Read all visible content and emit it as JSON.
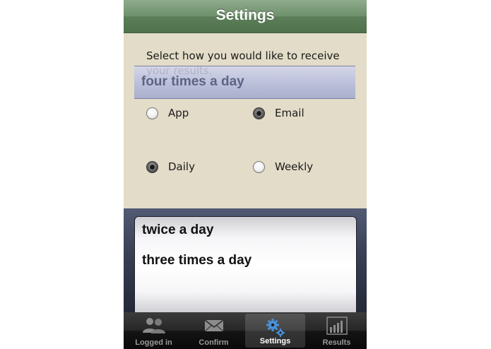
{
  "nav": {
    "title": "Settings"
  },
  "instructions": "Select how you would like to receive your results.",
  "options": {
    "app": {
      "label": "App",
      "checked": false
    },
    "email": {
      "label": "Email",
      "checked": true
    },
    "daily": {
      "label": "Daily",
      "checked": true
    },
    "weekly": {
      "label": "Weekly",
      "checked": false
    }
  },
  "picker": {
    "rows": [
      "twice a day",
      "three times a day"
    ],
    "selected": "four times a day"
  },
  "tabs": [
    {
      "label": "Logged in",
      "icon": "users-icon",
      "active": false
    },
    {
      "label": "Confirm",
      "icon": "envelope-icon",
      "active": false
    },
    {
      "label": "Settings",
      "icon": "gears-icon",
      "active": true
    },
    {
      "label": "Results",
      "icon": "bar-chart-icon",
      "active": false
    }
  ],
  "colors": {
    "nav": "#6e906b",
    "background": "#e3dcc8",
    "tab_active_icon": "#4a90d9"
  }
}
